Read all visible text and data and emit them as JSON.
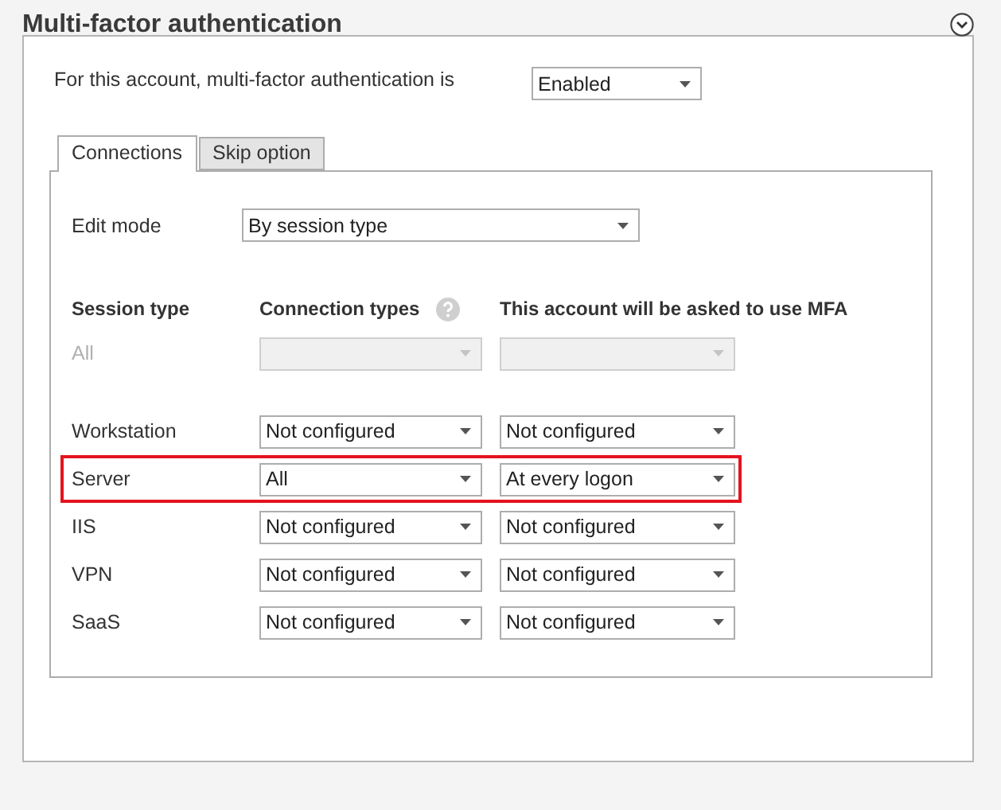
{
  "title": "Multi-factor authentication",
  "mfa_status": {
    "label": "For this account, multi-factor authentication is",
    "value": "Enabled"
  },
  "tabs": [
    {
      "label": "Connections",
      "selected": true
    },
    {
      "label": "Skip option",
      "selected": false
    }
  ],
  "edit_mode": {
    "label": "Edit mode",
    "value": "By session type"
  },
  "columns": [
    "Session type",
    "Connection types",
    "This account will be asked to use MFA"
  ],
  "rows": [
    {
      "session_type": "All",
      "disabled": true,
      "highlighted": false
    },
    {
      "session_type": "Workstation",
      "disabled": false,
      "highlighted": false,
      "connection_types": "Not configured",
      "mfa": "Not configured"
    },
    {
      "session_type": "Server",
      "disabled": false,
      "highlighted": true,
      "connection_types": "All",
      "mfa": "At every logon"
    },
    {
      "session_type": "IIS",
      "disabled": false,
      "highlighted": false,
      "connection_types": "Not configured",
      "mfa": "Not configured"
    },
    {
      "session_type": "VPN",
      "disabled": false,
      "highlighted": false,
      "connection_types": "Not configured",
      "mfa": "Not configured"
    },
    {
      "session_type": "SaaS",
      "disabled": false,
      "highlighted": false,
      "connection_types": "Not configured",
      "mfa": "Not configured"
    }
  ]
}
